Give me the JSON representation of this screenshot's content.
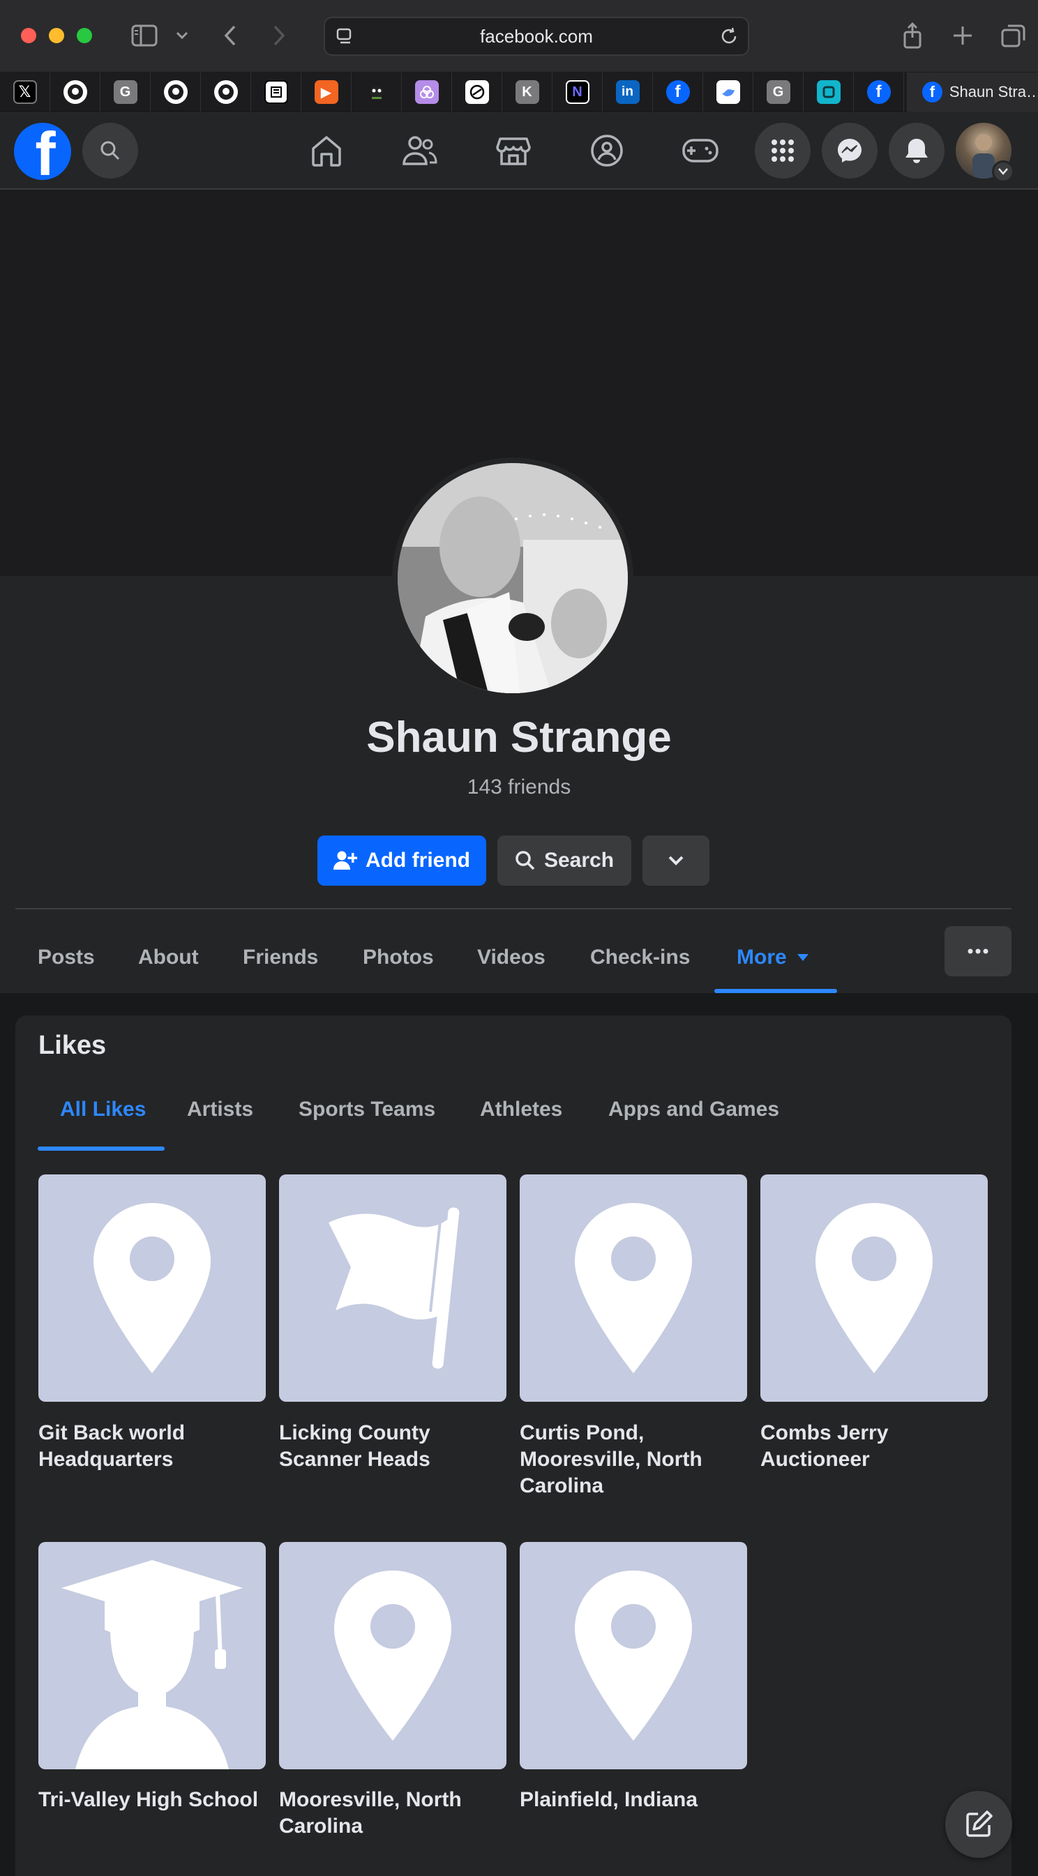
{
  "browser": {
    "url": "facebook.com",
    "active_tab_title": "Shaun Stra…",
    "favicons": [
      "x-icon",
      "github-icon",
      "g-icon",
      "github-icon",
      "github-icon",
      "notion-like-icon",
      "orange-app-icon",
      "creature-icon",
      "purple-app-icon",
      "openai-icon",
      "k-icon",
      "n-icon",
      "linkedin-icon",
      "facebook-icon",
      "bird-icon",
      "g-icon",
      "teal-app-icon",
      "facebook-icon"
    ],
    "favicon_letters": {
      "g": "G",
      "k": "K",
      "n": "N",
      "in": "in",
      "f": "f"
    }
  },
  "profile": {
    "name": "Shaun Strange",
    "friends": "143 friends",
    "add_friend_label": "Add friend",
    "search_label": "Search"
  },
  "tabs": [
    "Posts",
    "About",
    "Friends",
    "Photos",
    "Videos",
    "Check-ins",
    "More"
  ],
  "likes": {
    "title": "Likes",
    "subtabs": [
      "All Likes",
      "Artists",
      "Sports Teams",
      "Athletes",
      "Apps and Games"
    ],
    "items": [
      {
        "label_line1": "Git Back world",
        "label_line2": "Headquarters",
        "label_line3": "",
        "icon": "pin-icon"
      },
      {
        "label_line1": "Licking County",
        "label_line2": "Scanner Heads",
        "label_line3": "",
        "icon": "flag-icon"
      },
      {
        "label_line1": "Curtis Pond,",
        "label_line2": "Mooresville, North",
        "label_line3": "Carolina",
        "icon": "pin-icon"
      },
      {
        "label_line1": "Combs Jerry",
        "label_line2": "Auctioneer",
        "label_line3": "",
        "icon": "pin-icon"
      },
      {
        "label_line1": "Tri-Valley High School",
        "label_line2": "",
        "label_line3": "",
        "icon": "graduate-icon"
      },
      {
        "label_line1": "Mooresville, North",
        "label_line2": "Carolina",
        "label_line3": "",
        "icon": "pin-icon"
      },
      {
        "label_line1": "Plainfield, Indiana",
        "label_line2": "",
        "label_line3": "",
        "icon": "pin-icon"
      }
    ]
  },
  "colors": {
    "accent": "#0866ff",
    "active_tab": "#2d88ff",
    "tile_bg": "#c5cbe0"
  }
}
